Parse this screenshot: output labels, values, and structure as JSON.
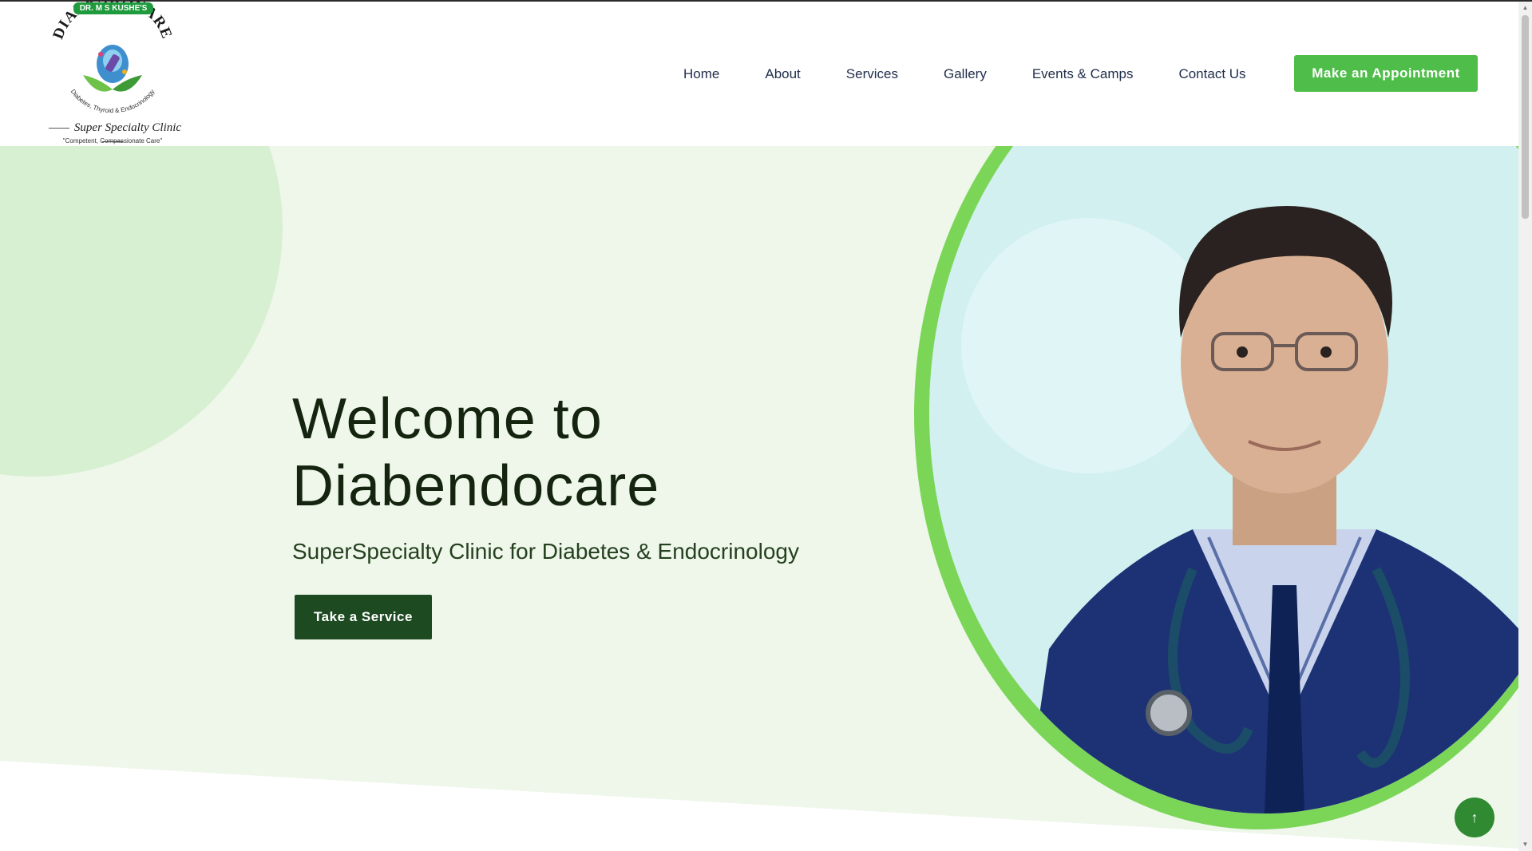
{
  "logo": {
    "badge": "DR. M S KUSHE'S",
    "brand": "DIABENDOCARE",
    "specialty": "Diabetes, Thyroid & Endocrinology",
    "tagline": "Super Specialty Clinic",
    "motto": "\"Competent, Compassionate Care\""
  },
  "nav": {
    "items": [
      "Home",
      "About",
      "Services",
      "Gallery",
      "Events & Camps",
      "Contact Us"
    ],
    "cta": "Make an Appointment"
  },
  "hero": {
    "title": "Welcome to Diabendocare",
    "subtitle": "SuperSpecialty Clinic for Diabetes & Endocrinology",
    "button": "Take a Service"
  },
  "back_to_top": "↑",
  "colors": {
    "accent_green": "#4fbd4a",
    "dark_green": "#1e4a22",
    "hero_bg": "#eef7ea",
    "ring_green": "#7bd658"
  },
  "icons": {
    "back_to_top": "arrow-up-icon"
  }
}
